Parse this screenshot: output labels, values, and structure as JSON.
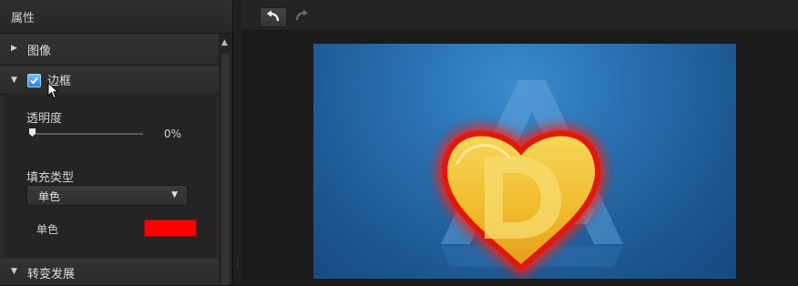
{
  "panel": {
    "title": "属性",
    "sections": {
      "image": {
        "label": "图像",
        "expanded": false
      },
      "border": {
        "label": "边框",
        "checked": true,
        "expanded": true
      },
      "transition": {
        "label": "转变发展",
        "expanded": true
      }
    },
    "border": {
      "opacity_label": "透明度",
      "opacity_value": "0%",
      "fill_type_label": "填充类型",
      "fill_type_value": "单色",
      "solid_label": "单色",
      "solid_color": "#ff0000"
    }
  },
  "toolbar": {
    "undo_icon": "undo-arrow-icon",
    "redo_icon": "redo-arrow-icon",
    "redo_enabled": false
  },
  "colors": {
    "accent": "#3a8fdf",
    "preview_background": "#1f5a97",
    "heart_fill": "#f2c12e",
    "heart_glow": "#ff1a0a"
  }
}
